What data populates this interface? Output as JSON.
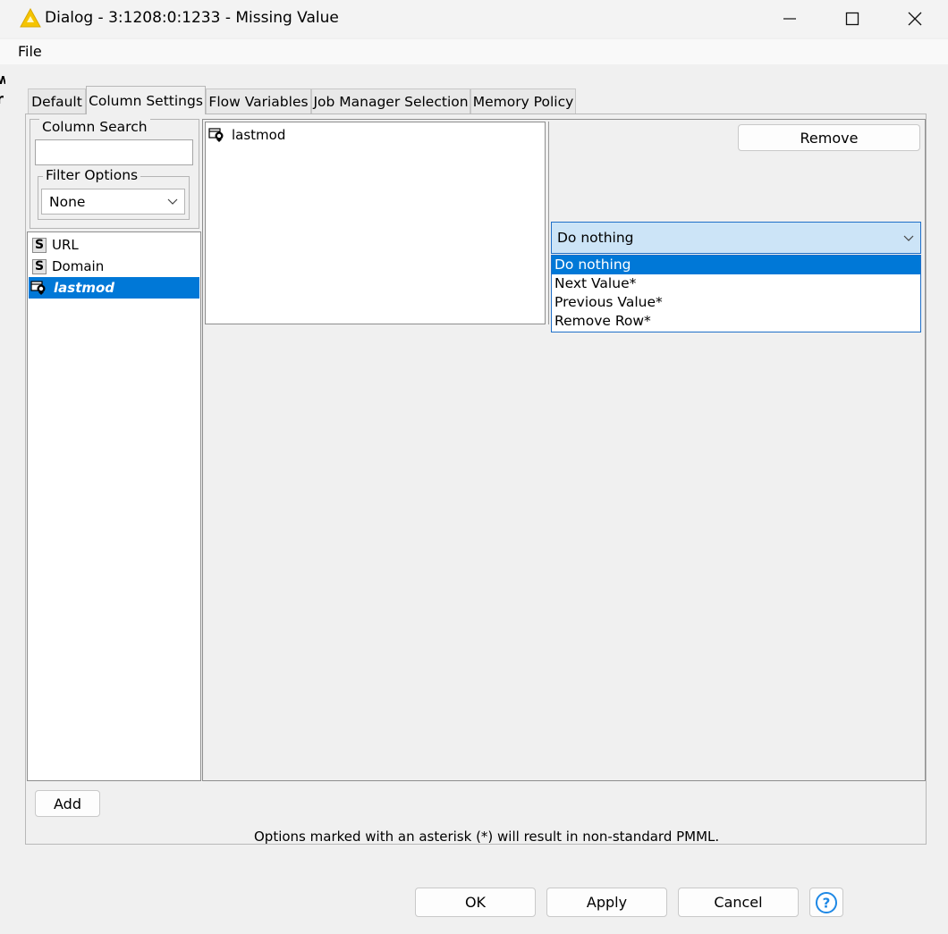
{
  "window": {
    "title": "Dialog - 3:1208:0:1233 - Missing Value"
  },
  "menu": {
    "file_label": "File"
  },
  "tabs": [
    {
      "label": "Default"
    },
    {
      "label": "Column Settings"
    },
    {
      "label": "Flow Variables"
    },
    {
      "label": "Job Manager Selection"
    },
    {
      "label": "Memory Policy"
    }
  ],
  "active_tab": "Column Settings",
  "column_search": {
    "group_label": "Column Search",
    "value": "",
    "filter_group_label": "Filter Options",
    "filter_value": "None"
  },
  "columns": [
    {
      "type": "S",
      "name": "URL"
    },
    {
      "type": "S",
      "name": "Domain"
    },
    {
      "type": "datetime",
      "name": "lastmod"
    }
  ],
  "selected_column": "lastmod",
  "selected_columns_list": [
    {
      "name": "lastmod"
    }
  ],
  "remove_label": "Remove",
  "strategy_combo": {
    "selected": "Do nothing",
    "options": [
      "Do nothing",
      "Next Value*",
      "Previous Value*",
      "Remove Row*"
    ]
  },
  "add_label": "Add",
  "footer_note": "Options marked with an asterisk (*) will result in non-standard PMML.",
  "buttons": {
    "ok": "OK",
    "apply": "Apply",
    "cancel": "Cancel"
  },
  "colors": {
    "selection": "#0078d7",
    "combo_open_bg": "#cce4f7",
    "warning_icon": "#f5c400"
  }
}
